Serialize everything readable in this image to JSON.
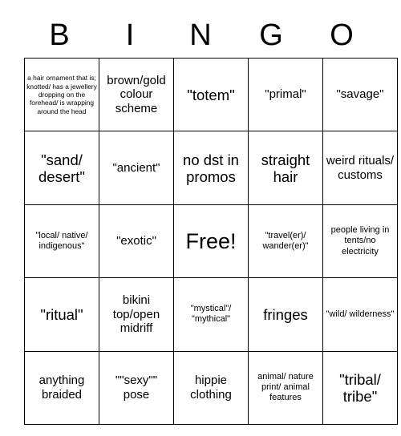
{
  "card": {
    "title_letters": [
      "B",
      "I",
      "N",
      "G",
      "O"
    ],
    "rows": [
      [
        {
          "text": "a hair ornament that is; knotted/ has a jewellery dropping on the forehead/ is wrapping around the head",
          "size": "fs-xs"
        },
        {
          "text": "brown/gold colour scheme",
          "size": "fs-m"
        },
        {
          "text": "\"totem\"",
          "size": "fs-l"
        },
        {
          "text": "\"primal\"",
          "size": "fs-m"
        },
        {
          "text": "\"savage\"",
          "size": "fs-m"
        }
      ],
      [
        {
          "text": "\"sand/ desert\"",
          "size": "fs-l"
        },
        {
          "text": "\"ancient\"",
          "size": "fs-m"
        },
        {
          "text": "no dst in promos",
          "size": "fs-l"
        },
        {
          "text": "straight hair",
          "size": "fs-l"
        },
        {
          "text": "weird rituals/ customs",
          "size": "fs-m"
        }
      ],
      [
        {
          "text": "\"local/ native/ indigenous\"",
          "size": "fs-s"
        },
        {
          "text": "\"exotic\"",
          "size": "fs-m"
        },
        {
          "text": "Free!",
          "size": "fs-free"
        },
        {
          "text": "\"travel(er)/ wander(er)\"",
          "size": "fs-s"
        },
        {
          "text": "people living in tents/no electricity",
          "size": "fs-s"
        }
      ],
      [
        {
          "text": "\"ritual\"",
          "size": "fs-l"
        },
        {
          "text": "bikini top/open midriff",
          "size": "fs-m"
        },
        {
          "text": "\"mystical\"/ \"mythical\"",
          "size": "fs-s"
        },
        {
          "text": "fringes",
          "size": "fs-l"
        },
        {
          "text": "\"wild/ wilderness\"",
          "size": "fs-s"
        }
      ],
      [
        {
          "text": "anything braided",
          "size": "fs-m"
        },
        {
          "text": "\"\"sexy\"\" pose",
          "size": "fs-m"
        },
        {
          "text": "hippie clothing",
          "size": "fs-m"
        },
        {
          "text": "animal/ nature print/ animal features",
          "size": "fs-s"
        },
        {
          "text": "\"tribal/ tribe\"",
          "size": "fs-l"
        }
      ]
    ]
  },
  "colors": {
    "background": "#ffffff",
    "text": "#000000",
    "border": "#000000"
  }
}
